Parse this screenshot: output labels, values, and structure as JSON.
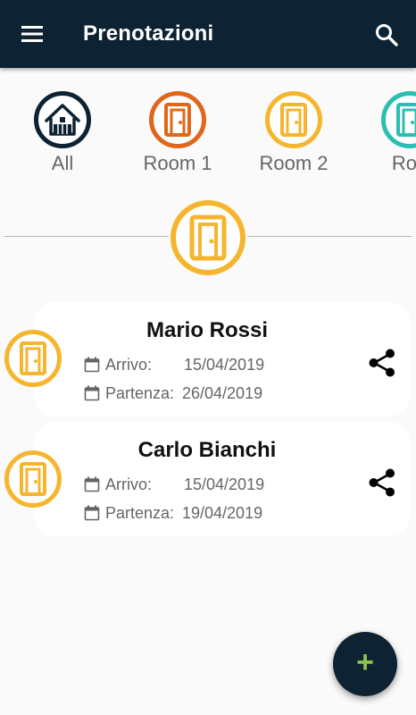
{
  "appbar": {
    "title": "Prenotazioni",
    "menu_icon": "menu-icon",
    "search_icon": "search-icon",
    "background": "#0d2232"
  },
  "rooms": [
    {
      "label": "All",
      "icon": "home-icon",
      "color": "#0d2232"
    },
    {
      "label": "Room 1",
      "icon": "door-icon",
      "color": "#e0671a"
    },
    {
      "label": "Room 2",
      "icon": "door-icon",
      "color": "#f6b52f"
    },
    {
      "label": "Roo",
      "icon": "door-icon",
      "color": "#2bbfb4"
    }
  ],
  "selected_room": {
    "icon": "door-icon",
    "color": "#f6b52f"
  },
  "bookings": [
    {
      "name": "Mario Rossi",
      "arrival_label": "Arrivo:",
      "arrival_date": "15/04/2019",
      "departure_label": "Partenza:",
      "departure_date": "26/04/2019",
      "room_color": "#f6b52f"
    },
    {
      "name": "Carlo Bianchi",
      "arrival_label": "Arrivo:",
      "arrival_date": "15/04/2019",
      "departure_label": "Partenza:",
      "departure_date": "19/04/2019",
      "room_color": "#f6b52f"
    }
  ],
  "fab": {
    "label": "+",
    "icon": "add-icon",
    "color": "#8bc34a"
  }
}
